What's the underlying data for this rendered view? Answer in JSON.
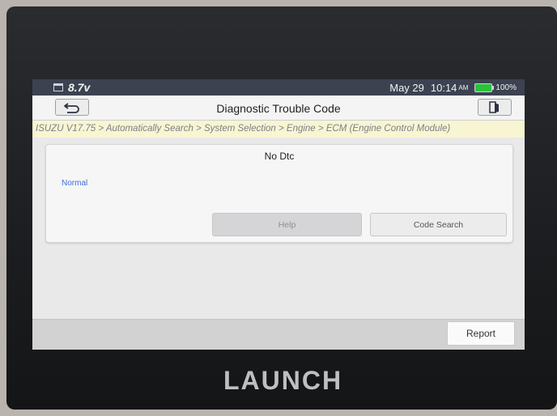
{
  "status_bar": {
    "voltage": "8.7v",
    "date": "May 29",
    "time": "10:14",
    "ampm": "AM",
    "battery": "100%"
  },
  "header": {
    "title": "Diagnostic Trouble Code"
  },
  "breadcrumb": "ISUZU V17.75 > Automatically Search > System Selection > Engine > ECM (Engine Control Module)",
  "dtc_card": {
    "title": "No Dtc",
    "status": "Normal",
    "help_label": "Help",
    "code_search_label": "Code Search"
  },
  "footer": {
    "report_label": "Report"
  },
  "device": {
    "brand": "LAUNCH"
  },
  "icons": {
    "back": "back-arrow-icon",
    "exit": "exit-icon",
    "calendar": "calendar-icon",
    "battery": "battery-icon"
  },
  "colors": {
    "status_bar": "#3c4250",
    "breadcrumb_bg": "#f8f5d2",
    "normal_text": "#3b6fd8",
    "battery": "#29c439"
  }
}
